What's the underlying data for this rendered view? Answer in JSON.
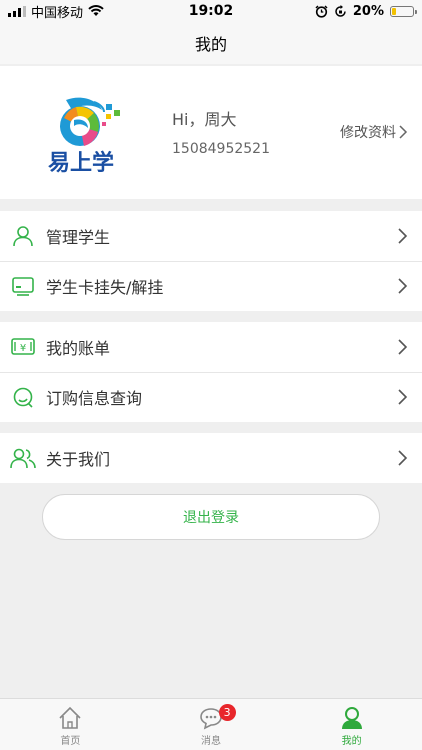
{
  "status_bar": {
    "carrier": "中国移动",
    "time": "19:02",
    "battery": "20%",
    "battery_level": 0.2
  },
  "nav": {
    "title": "我的"
  },
  "profile": {
    "logo_text": "易上学",
    "greeting": "Hi，周大",
    "phone": "15084952521",
    "edit_label": "修改资料"
  },
  "menu": {
    "manage_students": "管理学生",
    "student_card": "学生卡挂失/解挂",
    "my_bills": "我的账单",
    "order_query": "订购信息查询",
    "about_us": "关于我们"
  },
  "logout_label": "退出登录",
  "tabs": [
    {
      "label": "首页",
      "icon": "home-icon"
    },
    {
      "label": "消息",
      "icon": "chat-icon",
      "badge": "3"
    },
    {
      "label": "我的",
      "icon": "user-icon"
    }
  ],
  "colors": {
    "accent": "#34b34a",
    "badge": "#e8262b"
  }
}
